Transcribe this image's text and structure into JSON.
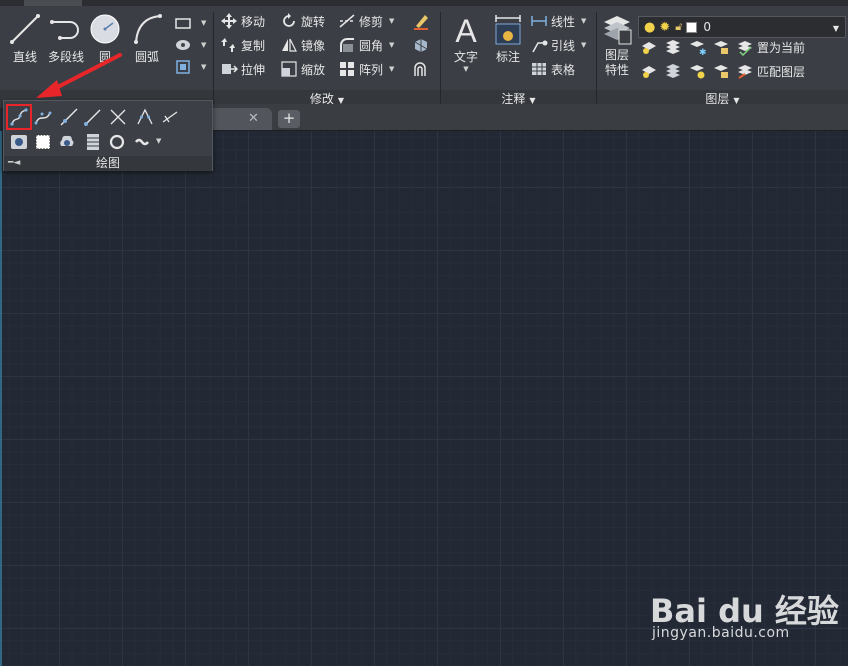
{
  "ribbon": {
    "draw": {
      "line": "直线",
      "polyline": "多段线",
      "circle": "圆",
      "arc": "圆弧"
    },
    "modify": {
      "title": "修改",
      "move": "移动",
      "rotate": "旋转",
      "trim": "修剪",
      "copy": "复制",
      "mirror": "镜像",
      "fillet": "圆角",
      "stretch": "拉伸",
      "scale": "缩放",
      "array": "阵列"
    },
    "annotation": {
      "title": "注释",
      "text": "文字",
      "dimension": "标注",
      "linear": "线性",
      "leader": "引线",
      "table": "表格"
    },
    "layers": {
      "title": "图层",
      "properties_line1": "图层",
      "properties_line2": "特性",
      "current_layer": "0",
      "make_current": "置为当前",
      "match_layer": "匹配图层"
    }
  },
  "draw_panel": {
    "title": "绘图",
    "highlight_color": "#e8262a"
  },
  "watermark": {
    "brand_text": "Bai du 经验",
    "url": "jingyan.baidu.com"
  }
}
